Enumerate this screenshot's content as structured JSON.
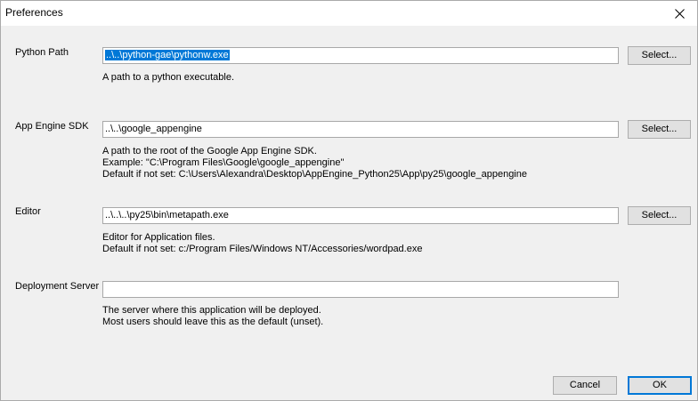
{
  "window": {
    "title": "Preferences",
    "close_glyph": "✕"
  },
  "rows": [
    {
      "label": "Python Path",
      "value": "..\\..\\python-gae\\pythonw.exe",
      "value_selected": true,
      "button": "Select...",
      "desc": [
        "A path to a python executable."
      ]
    },
    {
      "label": "App Engine SDK",
      "value": "..\\..\\google_appengine",
      "button": "Select...",
      "desc": [
        "A path to the root of the Google App Engine SDK.",
        "Example: \"C:\\Program Files\\Google\\google_appengine\"",
        "Default if not set: C:\\Users\\Alexandra\\Desktop\\AppEngine_Python25\\App\\py25\\google_appengine"
      ]
    },
    {
      "label": "Editor",
      "value": "..\\..\\..\\py25\\bin\\metapath.exe",
      "button": "Select...",
      "desc": [
        "Editor for Application files.",
        "Default if not set: c:/Program Files/Windows NT/Accessories/wordpad.exe"
      ]
    },
    {
      "label": "Deployment Server",
      "value": "",
      "desc": [
        "The server where this application will be deployed.",
        "Most users should leave this as the default (unset)."
      ]
    }
  ],
  "footer": {
    "cancel_label": "Cancel",
    "ok_label": "OK"
  },
  "colors": {
    "selection": "#0078d7",
    "background": "#f0f0f0"
  },
  "icons": {
    "close": "close-icon"
  }
}
